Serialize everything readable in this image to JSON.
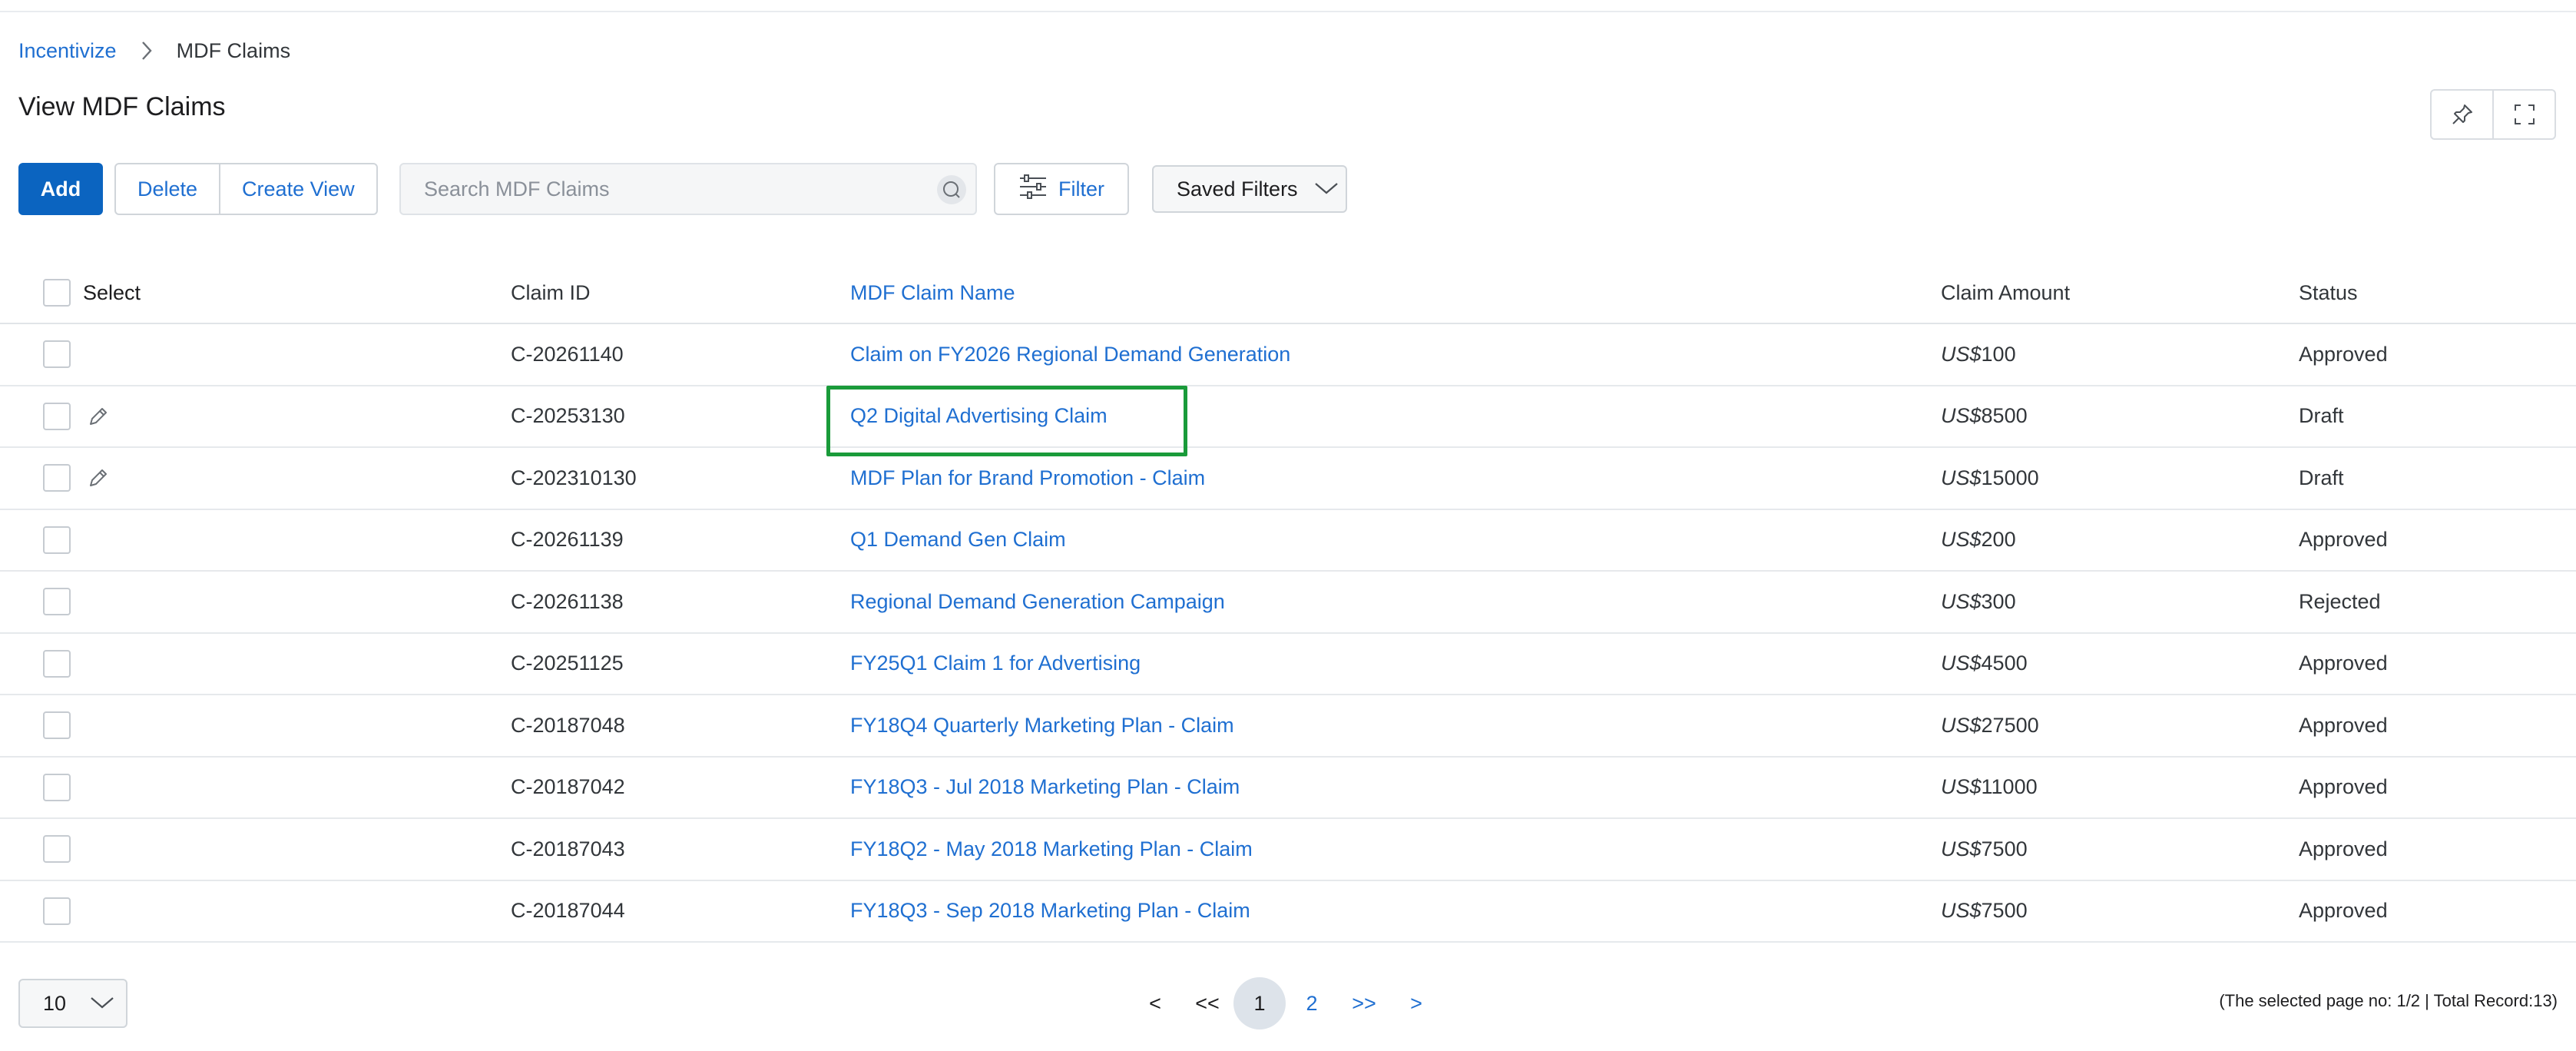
{
  "breadcrumb": {
    "root": "Incentivize",
    "current": "MDF Claims"
  },
  "page": {
    "title": "View MDF Claims"
  },
  "toolbar": {
    "add_label": "Add",
    "delete_label": "Delete",
    "create_view_label": "Create View",
    "search_placeholder": "Search MDF Claims",
    "filter_label": "Filter",
    "saved_filters_label": "Saved Filters"
  },
  "table": {
    "headers": {
      "select": "Select",
      "claim_id": "Claim ID",
      "name": "MDF Claim Name",
      "amount": "Claim Amount",
      "status": "Status"
    },
    "currency": "US$",
    "rows": [
      {
        "id": "C-20261140",
        "name": "Claim on FY2026 Regional Demand Generation",
        "amount": "100",
        "status": "Approved",
        "editable": false
      },
      {
        "id": "C-20253130",
        "name": "Q2 Digital Advertising Claim",
        "amount": "8500",
        "status": "Draft",
        "editable": true
      },
      {
        "id": "C-202310130",
        "name": "MDF Plan for Brand Promotion - Claim",
        "amount": "15000",
        "status": "Draft",
        "editable": true
      },
      {
        "id": "C-20261139",
        "name": "Q1 Demand Gen Claim",
        "amount": "200",
        "status": "Approved",
        "editable": false
      },
      {
        "id": "C-20261138",
        "name": "Regional Demand Generation Campaign",
        "amount": "300",
        "status": "Rejected",
        "editable": false
      },
      {
        "id": "C-20251125",
        "name": "FY25Q1 Claim 1 for Advertising",
        "amount": "4500",
        "status": "Approved",
        "editable": false
      },
      {
        "id": "C-20187048",
        "name": "FY18Q4 Quarterly Marketing Plan - Claim",
        "amount": "27500",
        "status": "Approved",
        "editable": false
      },
      {
        "id": "C-20187042",
        "name": "FY18Q3 - Jul 2018 Marketing Plan - Claim",
        "amount": "11000",
        "status": "Approved",
        "editable": false
      },
      {
        "id": "C-20187043",
        "name": "FY18Q2 - May 2018 Marketing Plan - Claim",
        "amount": "7500",
        "status": "Approved",
        "editable": false
      },
      {
        "id": "C-20187044",
        "name": "FY18Q3 - Sep 2018 Marketing Plan - Claim",
        "amount": "7500",
        "status": "Approved",
        "editable": false
      }
    ]
  },
  "pagination": {
    "page_size": "10",
    "first": "<",
    "prev": "<<",
    "pages": [
      "1",
      "2"
    ],
    "current_page": "1",
    "next": ">>",
    "last": ">",
    "info": "(The selected page no: 1/2 | Total Record:13)"
  },
  "colors": {
    "accent": "#0b64c0",
    "link": "#1f6fd1",
    "highlight": "#1a9b3a"
  },
  "icons": [
    "chevron-right-icon",
    "pin-icon",
    "fullscreen-icon",
    "search-icon",
    "filter-sliders-icon",
    "chevron-down-icon",
    "pencil-icon"
  ]
}
